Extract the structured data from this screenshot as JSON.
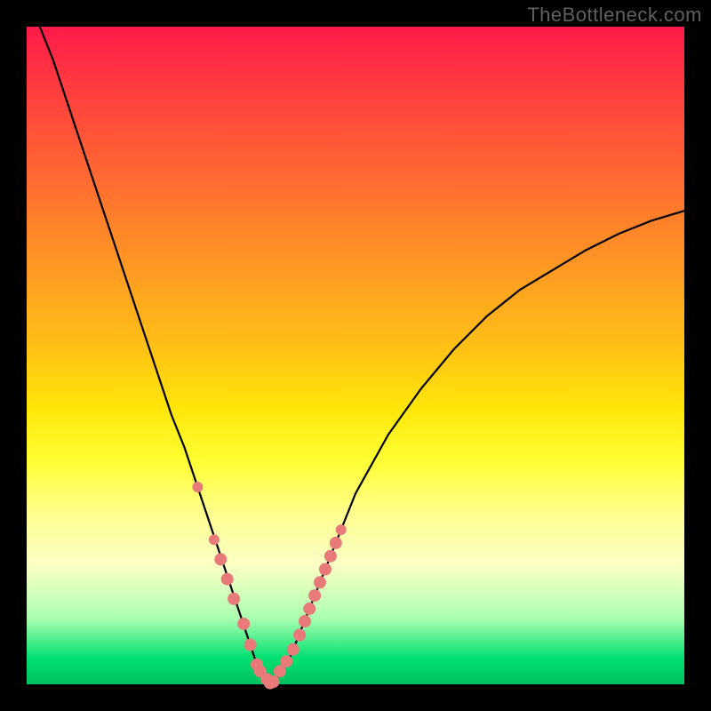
{
  "watermark": "TheBottleneck.com",
  "colors": {
    "background": "#000000",
    "curve": "#000000",
    "marker_fill": "#e97a7a",
    "marker_stroke": "#c95a5a"
  },
  "chart_data": {
    "type": "line",
    "title": "",
    "xlabel": "",
    "ylabel": "",
    "xlim": [
      0,
      100
    ],
    "ylim": [
      0,
      100
    ],
    "series": [
      {
        "name": "bottleneck-curve",
        "x": [
          2,
          4,
          6,
          8,
          10,
          12,
          14,
          16,
          18,
          20,
          22,
          24,
          26,
          28,
          30,
          32,
          33,
          34,
          35,
          36,
          37,
          38,
          40,
          42,
          44,
          46,
          48,
          50,
          55,
          60,
          65,
          70,
          75,
          80,
          85,
          90,
          95,
          100
        ],
        "values": [
          100,
          95,
          89,
          83,
          77,
          71,
          65,
          59,
          53,
          47,
          41,
          36,
          30,
          24,
          18,
          12,
          9,
          6,
          3,
          1,
          0.2,
          1,
          4,
          9,
          14,
          19,
          24,
          29,
          38,
          45,
          51,
          56,
          60,
          63,
          66,
          68.5,
          70.5,
          72
        ]
      }
    ],
    "markers": {
      "name": "highlighted-points-near-minimum",
      "x": [
        26,
        28.5,
        29.5,
        30.5,
        31.5,
        33,
        34,
        35,
        35.5,
        36.5,
        37,
        37.5,
        38.5,
        39.5,
        40.5,
        41.5,
        42.3,
        43,
        43.8,
        44.6,
        45.4,
        46.2,
        47,
        47.8
      ],
      "values": [
        30,
        22,
        19,
        16,
        13,
        9.2,
        6,
        3,
        2,
        0.8,
        0.2,
        0.4,
        2,
        3.5,
        5.3,
        7.5,
        9.6,
        11.5,
        13.5,
        15.5,
        17.5,
        19.5,
        21.5,
        23.5
      ],
      "radius": [
        6,
        6,
        7,
        7,
        7,
        7,
        7,
        7,
        7,
        7,
        7,
        7,
        7,
        7,
        7,
        7,
        7,
        7,
        7,
        7,
        7,
        7,
        7,
        6
      ]
    }
  }
}
